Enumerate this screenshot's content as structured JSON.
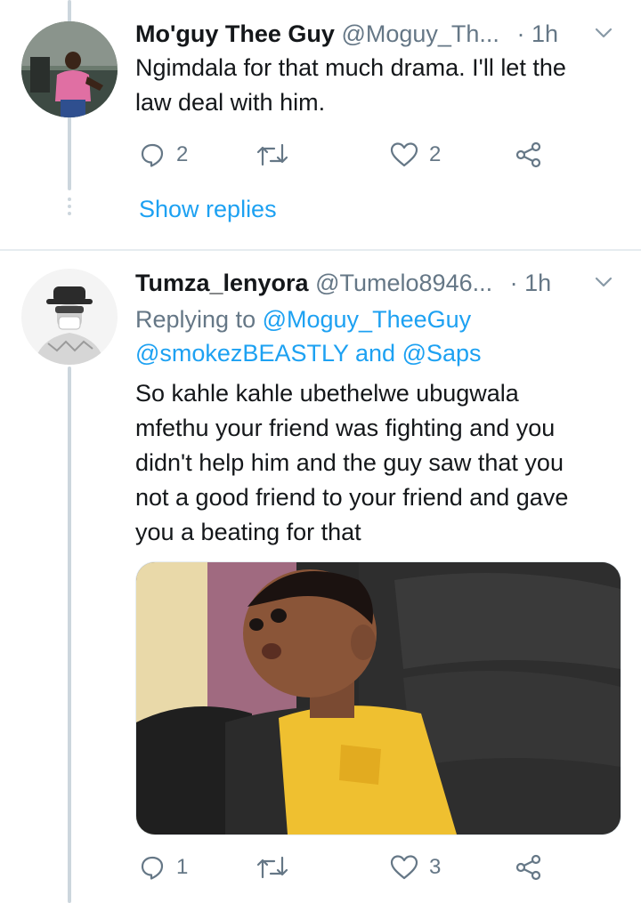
{
  "tweets": [
    {
      "name": "Mo'guy Thee Guy",
      "handle": "@Moguy_Th...",
      "time": "· 1h",
      "text_lines": [
        "Ngimdala for that much drama. I'll let the",
        "law deal with him."
      ],
      "reply_count": "2",
      "retweet_count": "",
      "like_count": "2",
      "show_replies": "Show replies"
    },
    {
      "name": "Tumza_lenyora",
      "handle": "@Tumelo8946...",
      "time": "· 1h",
      "replying_prefix": "Replying to",
      "replying_to": [
        "@Moguy_TheeGuy",
        "@smokezBEASTLY",
        "@Saps"
      ],
      "replying_and": "and",
      "text_lines": [
        "So kahle kahle ubethelwe ubugwala",
        "mfethu your friend was fighting and you",
        "didn't help him and the guy saw that you",
        "not a good friend to your friend and gave",
        "you a beating for that"
      ],
      "reply_count": "1",
      "retweet_count": "",
      "like_count": "3"
    }
  ],
  "icons": {
    "reply": "reply-icon",
    "retweet": "retweet-icon",
    "like": "heart-icon",
    "share": "share-icon",
    "more": "chevron-down-icon"
  },
  "colors": {
    "link": "#1da1f2",
    "secondary_text": "#657786",
    "thread_line": "#ccd6dd"
  }
}
